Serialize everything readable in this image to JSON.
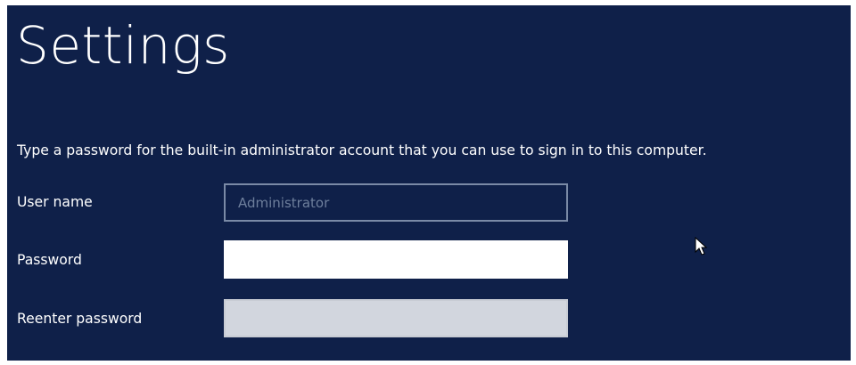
{
  "page": {
    "title": "Settings",
    "instruction": "Type a password for the built-in administrator account that you can use to sign in to this computer."
  },
  "form": {
    "username": {
      "label": "User name",
      "value": "Administrator"
    },
    "password": {
      "label": "Password",
      "value": ""
    },
    "reenter_password": {
      "label": "Reenter password",
      "value": ""
    }
  },
  "colors": {
    "background": "#0f2049",
    "text": "#ffffff",
    "disabled_text": "#6e7f9c",
    "input_active": "#ffffff",
    "input_disabled": "#d2d6de"
  },
  "icons": {
    "cursor": "mouse-pointer-icon"
  }
}
